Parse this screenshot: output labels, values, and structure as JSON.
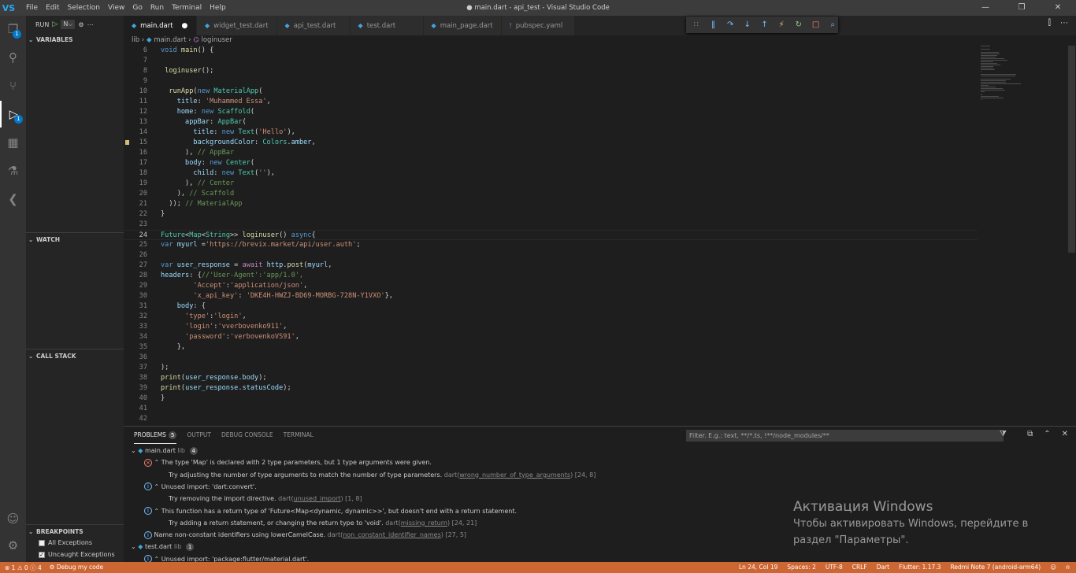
{
  "window": {
    "title": "● main.dart - api_test - Visual Studio Code",
    "logo": "VS",
    "menu": [
      "File",
      "Edit",
      "Selection",
      "View",
      "Go",
      "Run",
      "Terminal",
      "Help"
    ],
    "controls": [
      "—",
      "❐",
      "✕"
    ]
  },
  "activity": {
    "items": [
      {
        "name": "explorer-icon",
        "glyph": "❐",
        "badge": "1"
      },
      {
        "name": "search-icon",
        "glyph": "⚲",
        "badge": ""
      },
      {
        "name": "source-control-icon",
        "glyph": "⑂",
        "badge": ""
      },
      {
        "name": "run-debug-icon",
        "glyph": "▷",
        "badge": "1"
      },
      {
        "name": "extensions-icon",
        "glyph": "▦",
        "badge": ""
      },
      {
        "name": "testing-icon",
        "glyph": "⚗",
        "badge": ""
      },
      {
        "name": "flutter-icon",
        "glyph": "❮",
        "badge": ""
      }
    ],
    "account_glyph": "☺",
    "settings_glyph": "⚙"
  },
  "sidebar": {
    "run_label": "RUN",
    "run_play": "▷",
    "run_config": "N⌵",
    "run_gear": "⚙",
    "run_more": "⋯",
    "variables": "VARIABLES",
    "watch": "WATCH",
    "call_stack": "CALL STACK",
    "breakpoints": "BREAKPOINTS",
    "bp_items": [
      {
        "label": "All Exceptions",
        "checked": false
      },
      {
        "label": "Uncaught Exceptions",
        "checked": true
      }
    ]
  },
  "tabs": [
    {
      "label": "main.dart",
      "active": true,
      "dirty": "●",
      "kind": "dart"
    },
    {
      "label": "widget_test.dart",
      "active": false,
      "dirty": "",
      "kind": "dart"
    },
    {
      "label": "api_test.dart",
      "active": false,
      "dirty": "",
      "kind": "dart"
    },
    {
      "label": "test.dart",
      "active": false,
      "dirty": "",
      "kind": "dart"
    },
    {
      "label": "main_page.dart",
      "active": false,
      "dirty": "",
      "kind": "dart"
    },
    {
      "label": "pubspec.yaml",
      "active": false,
      "dirty": "",
      "kind": "yaml"
    }
  ],
  "debug_toolbar": [
    "∷",
    "‖",
    "↷",
    "↓",
    "↑",
    "⚡",
    "↻",
    "□",
    "⌕"
  ],
  "breadcrumb": {
    "folder": "lib",
    "file": "main.dart",
    "symbol": "loginuser"
  },
  "editor_actions": [
    "⫿",
    "⋯"
  ],
  "code_lines": [
    {
      "n": "6",
      "html": "<span class='k'>void</span> <span class='f'>main</span><span class='p'>() {</span>"
    },
    {
      "n": "7",
      "html": ""
    },
    {
      "n": "8",
      "html": " <span class='f'>loginuser</span><span class='p'>();</span>"
    },
    {
      "n": "9",
      "html": ""
    },
    {
      "n": "10",
      "html": "  <span class='f'>runApp</span><span class='p'>(</span><span class='k'>new</span> <span class='t'>MaterialApp</span><span class='p'>(</span>"
    },
    {
      "n": "11",
      "html": "    <span class='v'>title</span><span class='p'>: </span><span class='s'>'Muhammed Essa'</span><span class='p'>,</span>"
    },
    {
      "n": "12",
      "html": "    <span class='v'>home</span><span class='p'>: </span><span class='k'>new</span> <span class='t'>Scaffold</span><span class='p'>(</span>"
    },
    {
      "n": "13",
      "html": "      <span class='v'>appBar</span><span class='p'>: </span><span class='t'>AppBar</span><span class='p'>(</span>"
    },
    {
      "n": "14",
      "html": "        <span class='v'>title</span><span class='p'>: </span><span class='k'>new</span> <span class='t'>Text</span><span class='p'>(</span><span class='s'>'Hello'</span><span class='p'>),</span>"
    },
    {
      "n": "15",
      "html": "        <span class='v'>backgroundColor</span><span class='p'>: </span><span class='t'>Colors</span><span class='p'>.</span><span class='v'>amber</span><span class='p'>,</span>"
    },
    {
      "n": "16",
      "html": "      <span class='p'>), </span><span class='c'>// AppBar</span>"
    },
    {
      "n": "17",
      "html": "      <span class='v'>body</span><span class='p'>: </span><span class='k'>new</span> <span class='t'>Center</span><span class='p'>(</span>"
    },
    {
      "n": "18",
      "html": "        <span class='v'>child</span><span class='p'>: </span><span class='k'>new</span> <span class='t'>Text</span><span class='p'>(</span><span class='s'>''</span><span class='p'>),</span>"
    },
    {
      "n": "19",
      "html": "      <span class='p'>), </span><span class='c'>// Center</span>"
    },
    {
      "n": "20",
      "html": "    <span class='p'>), </span><span class='c'>// Scaffold</span>"
    },
    {
      "n": "21",
      "html": "  <span class='p'>)); </span><span class='c'>// MaterialApp</span>"
    },
    {
      "n": "22",
      "html": "<span class='p'>}</span>"
    },
    {
      "n": "23",
      "html": ""
    },
    {
      "n": "24",
      "html": "<span class='t'>Future</span><span class='p'>&lt;</span><span class='t'>Map</span><span class='p'>&lt;</span><span class='t'>String</span><span class='p'>&gt;&gt; </span><span class='f'>loginuser</span><span class='p'>() </span><span class='k'>async</span><span class='p'>{</span>"
    },
    {
      "n": "25",
      "html": "<span class='k'>var</span> <span class='v'>myurl</span> <span class='p'>=</span><span class='s'>'https://brevix.market/api/user.auth'</span><span class='p'>;</span>"
    },
    {
      "n": "26",
      "html": ""
    },
    {
      "n": "27",
      "html": "<span class='k'>var</span> <span class='v'>user_response</span> <span class='p'>= </span><span class='cl'>await</span> <span class='v'>http</span><span class='p'>.</span><span class='f'>post</span><span class='p'>(</span><span class='v'>myurl</span><span class='p'>,</span>"
    },
    {
      "n": "28",
      "html": "<span class='v'>headers</span><span class='p'>: {</span><span class='c'>//'User-Agent':'app/1.0',</span>"
    },
    {
      "n": "29",
      "html": "        <span class='s'>'Accept'</span><span class='p'>:</span><span class='s'>'application/json'</span><span class='p'>,</span>"
    },
    {
      "n": "30",
      "html": "        <span class='s'>'x_api_key'</span><span class='p'>: </span><span class='s'>'DKE4H-HWZJ-BD69-MORBG-728N-Y1VXO'</span><span class='p'>},</span>"
    },
    {
      "n": "31",
      "html": "    <span class='v'>body</span><span class='p'>: {</span>"
    },
    {
      "n": "32",
      "html": "      <span class='s'>'type'</span><span class='p'>:</span><span class='s'>'login'</span><span class='p'>,</span>"
    },
    {
      "n": "33",
      "html": "      <span class='s'>'login'</span><span class='p'>:</span><span class='s'>'vverbovenko911'</span><span class='p'>,</span>"
    },
    {
      "n": "34",
      "html": "      <span class='s'>'password'</span><span class='p'>:</span><span class='s'>'verbovenkoVS91'</span><span class='p'>,</span>"
    },
    {
      "n": "35",
      "html": "    <span class='p'>},</span>"
    },
    {
      "n": "36",
      "html": ""
    },
    {
      "n": "37",
      "html": "<span class='p'>);</span>"
    },
    {
      "n": "38",
      "html": "<span class='f'>print</span><span class='p'>(</span><span class='v'>user_response</span><span class='p'>.</span><span class='v'>body</span><span class='p'>);</span>"
    },
    {
      "n": "39",
      "html": "<span class='f'>print</span><span class='p'>(</span><span class='v'>user_response</span><span class='p'>.</span><span class='v'>statusCode</span><span class='p'>);</span>"
    },
    {
      "n": "40",
      "html": "<span class='p'>}</span>"
    },
    {
      "n": "41",
      "html": ""
    },
    {
      "n": "42",
      "html": ""
    }
  ],
  "panel": {
    "tabs": [
      {
        "label": "PROBLEMS",
        "count": "5",
        "active": true
      },
      {
        "label": "OUTPUT",
        "count": "",
        "active": false
      },
      {
        "label": "DEBUG CONSOLE",
        "count": "",
        "active": false
      },
      {
        "label": "TERMINAL",
        "count": "",
        "active": false
      }
    ],
    "filter_placeholder": "Filter. E.g.: text, **/*.ts, !**/node_modules/**",
    "filter_glyph": "⧩",
    "actions": [
      "⧉",
      "⌃",
      "✕"
    ],
    "rows": [
      {
        "kind": "file",
        "text": "main.dart",
        "dir": "lib",
        "count": "4"
      },
      {
        "kind": "error",
        "text": "The type 'Map' is declared with 2 type parameters, but 1 type arguments were given."
      },
      {
        "kind": "hint",
        "text": "Try adjusting the number of type arguments to match the number of type parameters.",
        "src": "dart",
        "code": "wrong_number_of_type_arguments",
        "pos": "[24, 8]"
      },
      {
        "kind": "info",
        "text": "Unused import: 'dart:convert'."
      },
      {
        "kind": "hint",
        "text": "Try removing the import directive.",
        "src": "dart",
        "code": "unused_import",
        "pos": "[1, 8]"
      },
      {
        "kind": "info",
        "text": "This function has a return type of 'Future<Map<dynamic, dynamic>>', but doesn't end with a return statement."
      },
      {
        "kind": "hint",
        "text": "Try adding a return statement, or changing the return type to 'void'.",
        "src": "dart",
        "code": "missing_return",
        "pos": "[24, 21]"
      },
      {
        "kind": "info-flat",
        "text": "Name non-constant identifiers using lowerCamelCase.",
        "src": "dart",
        "code": "non_constant_identifier_names",
        "pos": "[27, 5]"
      },
      {
        "kind": "file",
        "text": "test.dart",
        "dir": "lib",
        "count": "1"
      },
      {
        "kind": "info",
        "text": "Unused import: 'package:flutter/material.dart'."
      }
    ]
  },
  "watermark": {
    "title": "Активация Windows",
    "line1": "Чтобы активировать Windows, перейдите в",
    "line2": "раздел \"Параметры\"."
  },
  "status": {
    "errors": "⊗ 1 ⚠ 0 ⓘ 4",
    "debug": "⚙ Debug my code",
    "right": [
      "Ln 24, Col 19",
      "Spaces: 2",
      "UTF-8",
      "CRLF",
      "Dart",
      "Flutter: 1.17.3",
      "Redmi Note 7 (android-arm64)",
      "☺",
      "⍾"
    ]
  },
  "colors": {
    "statusbar": "#cc6633",
    "activitybar": "#333333",
    "sidebar": "#252526",
    "editor": "#1e1e1e"
  }
}
